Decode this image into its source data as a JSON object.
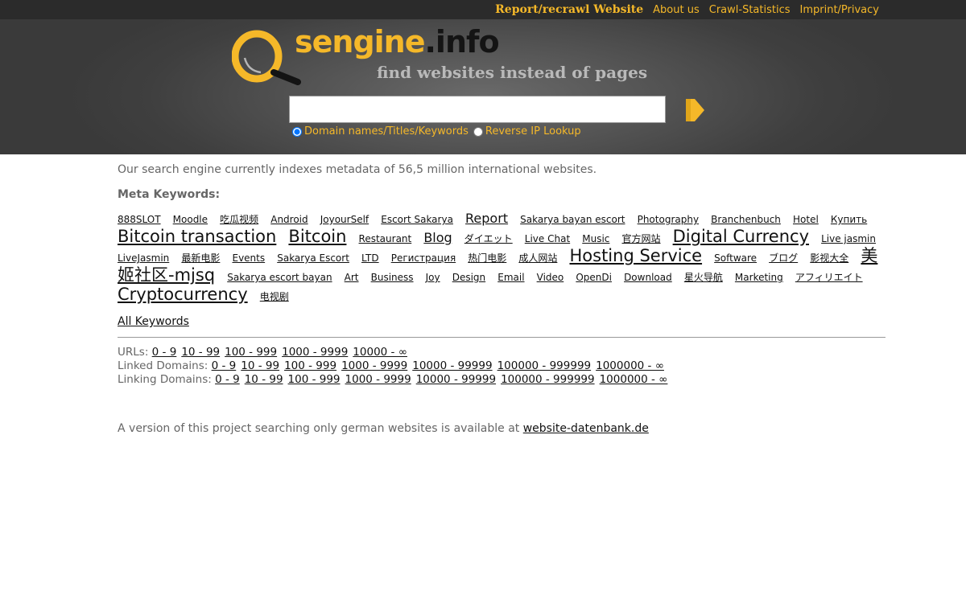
{
  "topnav": {
    "report": "Report/recrawl Website",
    "about": "About us",
    "crawl_stats": "Crawl-Statistics",
    "imprint": "Imprint/Privacy"
  },
  "logo": {
    "name_part1": "sengine",
    "name_part2": ".info",
    "tagline": "find websites instead of pages"
  },
  "search": {
    "value": "",
    "placeholder": "",
    "button_icon": "arrow-right-icon",
    "options": [
      {
        "label": "Domain names/Titles/Keywords",
        "checked": true
      },
      {
        "label": "Reverse IP Lookup",
        "checked": false
      }
    ]
  },
  "intro_text": "Our search engine currently indexes metadata of 56,5 million international websites.",
  "meta_heading": "Meta Keywords:",
  "keywords": [
    {
      "text": "888SLOT",
      "size": 1
    },
    {
      "text": "Moodle",
      "size": 1
    },
    {
      "text": "吃瓜视频",
      "size": 1
    },
    {
      "text": "Android",
      "size": 1
    },
    {
      "text": "JoyourSelf",
      "size": 1
    },
    {
      "text": "Escort Sakarya",
      "size": 1
    },
    {
      "text": "Report",
      "size": 2
    },
    {
      "text": "Sakarya bayan escort",
      "size": 1
    },
    {
      "text": "Photography",
      "size": 1
    },
    {
      "text": "Branchenbuch",
      "size": 1
    },
    {
      "text": "Hotel",
      "size": 1
    },
    {
      "text": "Купить",
      "size": 1
    },
    {
      "text": "Bitcoin transaction",
      "size": 3
    },
    {
      "text": "Bitcoin",
      "size": 3
    },
    {
      "text": "Restaurant",
      "size": 1
    },
    {
      "text": "Blog",
      "size": 2
    },
    {
      "text": "ダイエット",
      "size": 1
    },
    {
      "text": "Live Chat",
      "size": 1
    },
    {
      "text": "Music",
      "size": 1
    },
    {
      "text": "官方网站",
      "size": 1
    },
    {
      "text": "Digital Currency",
      "size": 3
    },
    {
      "text": "Live jasmin",
      "size": 1
    },
    {
      "text": "LiveJasmin",
      "size": 1
    },
    {
      "text": "最新电影",
      "size": 1
    },
    {
      "text": "Events",
      "size": 1
    },
    {
      "text": "Sakarya Escort",
      "size": 1
    },
    {
      "text": "LTD",
      "size": 1
    },
    {
      "text": "Регистрация",
      "size": 1
    },
    {
      "text": "热门电影",
      "size": 1
    },
    {
      "text": "成人网站",
      "size": 1
    },
    {
      "text": "Hosting Service",
      "size": 3
    },
    {
      "text": "Software",
      "size": 1
    },
    {
      "text": "ブログ",
      "size": 1
    },
    {
      "text": "影视大全",
      "size": 1
    },
    {
      "text": "美姬社区-mjsq",
      "size": 3
    },
    {
      "text": "Sakarya escort bayan",
      "size": 1
    },
    {
      "text": "Art",
      "size": 1
    },
    {
      "text": "Business",
      "size": 1
    },
    {
      "text": "Joy",
      "size": 1
    },
    {
      "text": "Design",
      "size": 1
    },
    {
      "text": "Email",
      "size": 1
    },
    {
      "text": "Video",
      "size": 1
    },
    {
      "text": "OpenDi",
      "size": 1
    },
    {
      "text": "Download",
      "size": 1
    },
    {
      "text": "星火导航",
      "size": 1
    },
    {
      "text": "Marketing",
      "size": 1
    },
    {
      "text": "アフィリエイト",
      "size": 1
    },
    {
      "text": "Cryptocurrency",
      "size": 3
    },
    {
      "text": "电视剧",
      "size": 1
    }
  ],
  "all_keywords": "All Keywords",
  "ranges": [
    {
      "label": "URLs:",
      "links": [
        "0 - 9",
        "10 - 99",
        "100 - 999",
        "1000 - 9999",
        "10000 - ∞"
      ]
    },
    {
      "label": "Linked Domains:",
      "links": [
        "0 - 9",
        "10 - 99",
        "100 - 999",
        "1000 - 9999",
        "10000 - 99999",
        "100000 - 999999",
        "1000000 - ∞"
      ]
    },
    {
      "label": "Linking Domains:",
      "links": [
        "0 - 9",
        "10 - 99",
        "100 - 999",
        "1000 - 9999",
        "10000 - 99999",
        "100000 - 999999",
        "1000000 - ∞"
      ]
    }
  ],
  "footer": {
    "text": "A version of this project searching only german websites is available at ",
    "link": "website-datenbank.de"
  },
  "colors": {
    "accent": "#f5b829",
    "topbar": "#2b2b2b",
    "header": "#4a4a4a",
    "text": "#666666",
    "link": "#111111"
  }
}
